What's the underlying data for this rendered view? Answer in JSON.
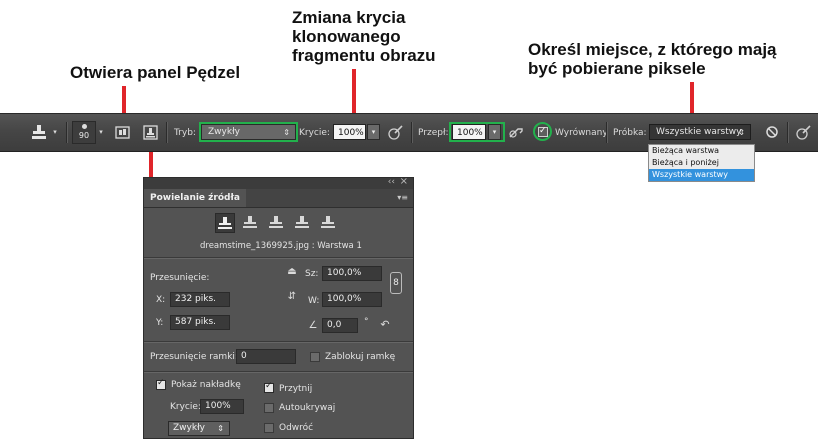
{
  "annotations": {
    "opacity_callout": "Zmiana krycia klonowanego fragmentu obrazu",
    "opacity_callout_lines": [
      "Zmiana krycia",
      "klonowanego",
      "fragmentu obrazu"
    ],
    "sample_callout_lines": [
      "Określ miejsce, z którego mają",
      "być pobierane piksele"
    ],
    "brush_panel_callout": "Otwiera panel Pędzel"
  },
  "colors": {
    "highlight_green": "#22b14c",
    "callout_red": "#e0252a",
    "menu_selected": "#3392dd"
  },
  "toolbar": {
    "tool_icon": "clone-stamp-icon",
    "brush_size": "90",
    "mode_label": "Tryb:",
    "mode_value": "Zwykły",
    "opacity_label": "Krycie:",
    "opacity_value": "100%",
    "flow_label": "Przepł:",
    "flow_value": "100%",
    "aligned_label": "Wyrównany",
    "sample_label": "Próbka:",
    "sample_value": "Wszystkie warstwy"
  },
  "sample_menu": {
    "options": [
      "Bieżąca warstwa",
      "Bieżąca i poniżej",
      "Wszystkie warstwy"
    ],
    "selected_index": 2
  },
  "panel": {
    "title": "Powielanie źródła",
    "source_info": "dreamstime_1369925.jpg : Warstwa 1",
    "offset_label": "Przesunięcie:",
    "x_label": "X:",
    "x_value": "232 piks.",
    "y_label": "Y:",
    "y_value": "587 piks.",
    "width_label": "Sz:",
    "width_value": "100,0%",
    "height_label": "W:",
    "height_value": "100,0%",
    "angle_value": "0,0",
    "angle_unit": "°",
    "frame_offset_label": "Przesunięcie ramki:",
    "frame_offset_value": "0",
    "lock_frame_label": "Zablokuj ramkę",
    "show_overlay_label": "Pokaż nakładkę",
    "show_overlay_checked": true,
    "overlay_opacity_label": "Krycie:",
    "overlay_opacity_value": "100%",
    "overlay_mode_value": "Zwykły",
    "clipped_label": "Przytnij",
    "clipped_checked": true,
    "autohide_label": "Autoukrywaj",
    "autohide_checked": false,
    "invert_label": "Odwróć",
    "invert_checked": false,
    "collapse_glyph": "‹‹",
    "close_glyph": "×"
  }
}
